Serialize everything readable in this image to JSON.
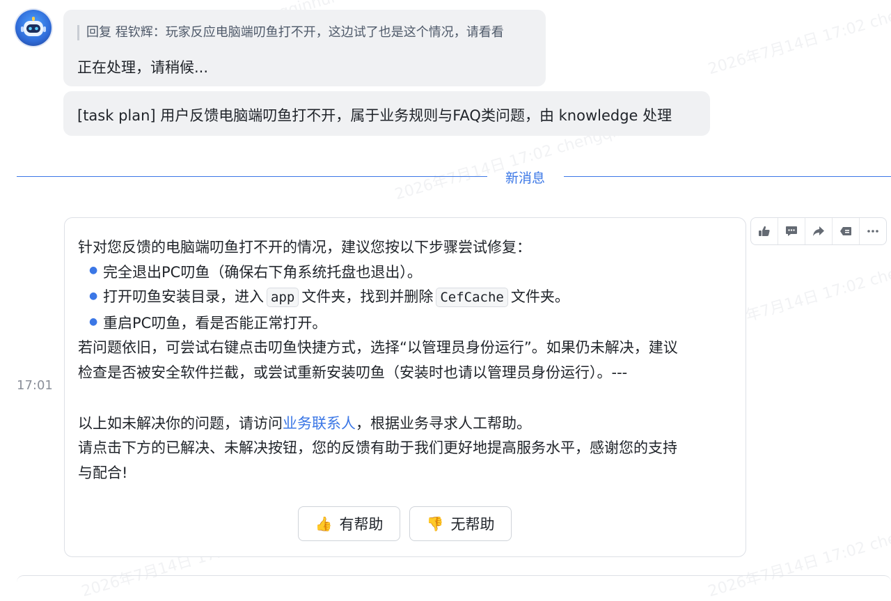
{
  "watermark": "2026年7月14日 17:02 chengqinhui",
  "history": {
    "reply_prefix": "回复",
    "reply_quote": "程钦辉：玩家反应电脑端叨鱼打不开，这边试了也是这个情况，请看看",
    "processing": "正在处理，请稍候...",
    "task_plan": "[task plan] 用户反馈电脑端叨鱼打不开，属于业务规则与FAQ类问题，由 knowledge 处理"
  },
  "divider": {
    "label": "新消息"
  },
  "message": {
    "time": "17:01",
    "intro": "针对您反馈的电脑端叨鱼打不开的情况，建议您按以下步骤尝试修复：",
    "step1": "完全退出PC叨鱼（确保右下角系统托盘也退出）。",
    "step2_a": "打开叨鱼安装目录，进入",
    "step2_code1": "app",
    "step2_b": "文件夹，找到并删除",
    "step2_code2": "CefCache",
    "step2_c": "文件夹。",
    "step3": "重启PC叨鱼，看是否能正常打开。",
    "para1_line1": "若问题依旧，可尝试右键点击叨鱼快捷方式，选择“以管理员身份运行”。如果仍未解决，建议",
    "para1_line2": "检查是否被安全软件拦截，或尝试重新安装叨鱼（安装时也请以管理员身份运行）。---",
    "para2_a": "以上如未解决你的问题，请访问",
    "para2_link": "业务联系人",
    "para2_b": "，根据业务寻求人工帮助。",
    "para3_line1": "请点击下方的已解决、未解决按钮，您的反馈有助于我们更好地提高服务水平，感谢您的支持",
    "para3_line2": "与配合!",
    "helpful_label": "有帮助",
    "unhelpful_label": "无帮助"
  },
  "actions": [
    "thumbs-up-icon",
    "comment-icon",
    "forward-icon",
    "tag-icon",
    "more-icon"
  ],
  "colors": {
    "accent": "#3b77e6",
    "bubble": "#f0f1f3"
  }
}
